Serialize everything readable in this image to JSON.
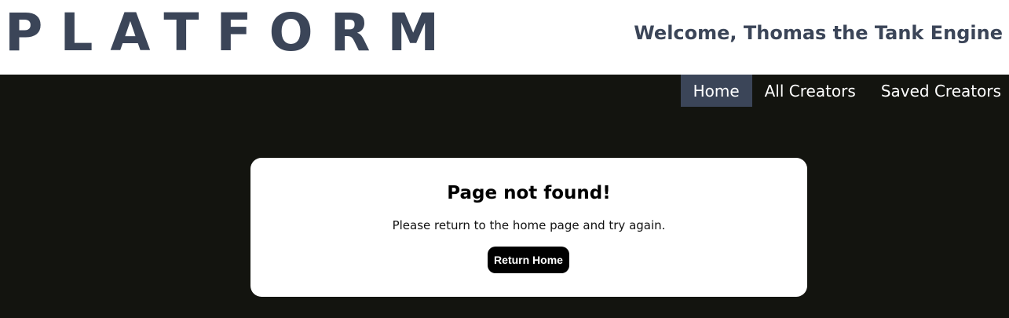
{
  "header": {
    "logo_text": "PLATFORM",
    "welcome_text": "Welcome, Thomas the Tank Engine"
  },
  "nav": {
    "items": [
      {
        "label": "Home",
        "active": true
      },
      {
        "label": "All Creators",
        "active": false
      },
      {
        "label": "Saved Creators",
        "active": false
      }
    ]
  },
  "error_card": {
    "title": "Page not found!",
    "message": "Please return to the home page and try again.",
    "button_label": "Return Home"
  },
  "colors": {
    "brand": "#3b4558",
    "background": "#13140f",
    "card": "#ffffff",
    "button": "#000000"
  }
}
